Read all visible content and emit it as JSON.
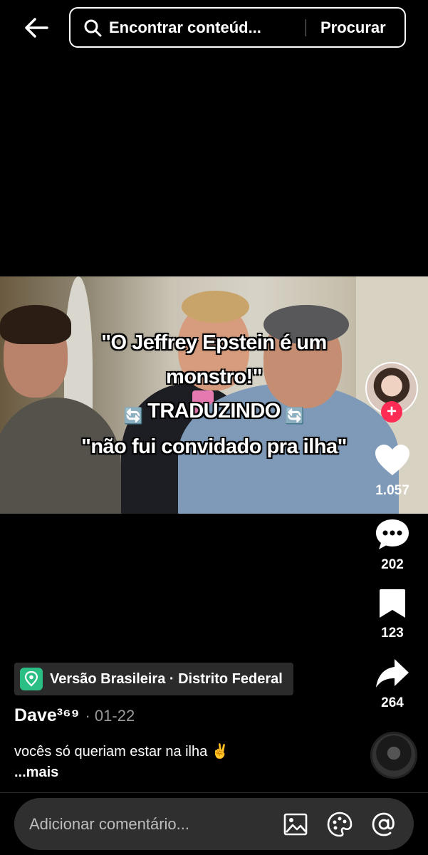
{
  "search": {
    "placeholder": "Encontrar conteúd...",
    "button_label": "Procurar"
  },
  "video": {
    "captions": [
      "\"O Jeffrey Epstein é um",
      "monstro!\"",
      "TRADUZINDO",
      "\"não fui convidado pra ilha\""
    ],
    "swap_emoji": "🔄"
  },
  "actions": {
    "follow_label": "+",
    "likes": "1.057",
    "comments": "202",
    "saves": "123",
    "shares": "264"
  },
  "post": {
    "location": "Versão Brasileira · Distrito Federal",
    "author": "Dave³⁶⁹",
    "date": "· 01-22",
    "description": "vocês só queriam estar na ilha ✌️",
    "more_label": "...mais"
  },
  "comment_bar": {
    "placeholder": "Adicionar comentário..."
  },
  "icons": {
    "back": "arrow-left-icon",
    "search": "search-icon",
    "like": "heart-icon",
    "comment": "comment-bubble-icon",
    "save": "bookmark-icon",
    "share": "share-arrow-icon",
    "image": "image-icon",
    "emoji": "emoji-icon",
    "mention": "at-icon",
    "location": "location-pin-icon"
  },
  "colors": {
    "follow": "#fe2c55",
    "location_icon": "#2bbf85",
    "background": "#000000"
  }
}
